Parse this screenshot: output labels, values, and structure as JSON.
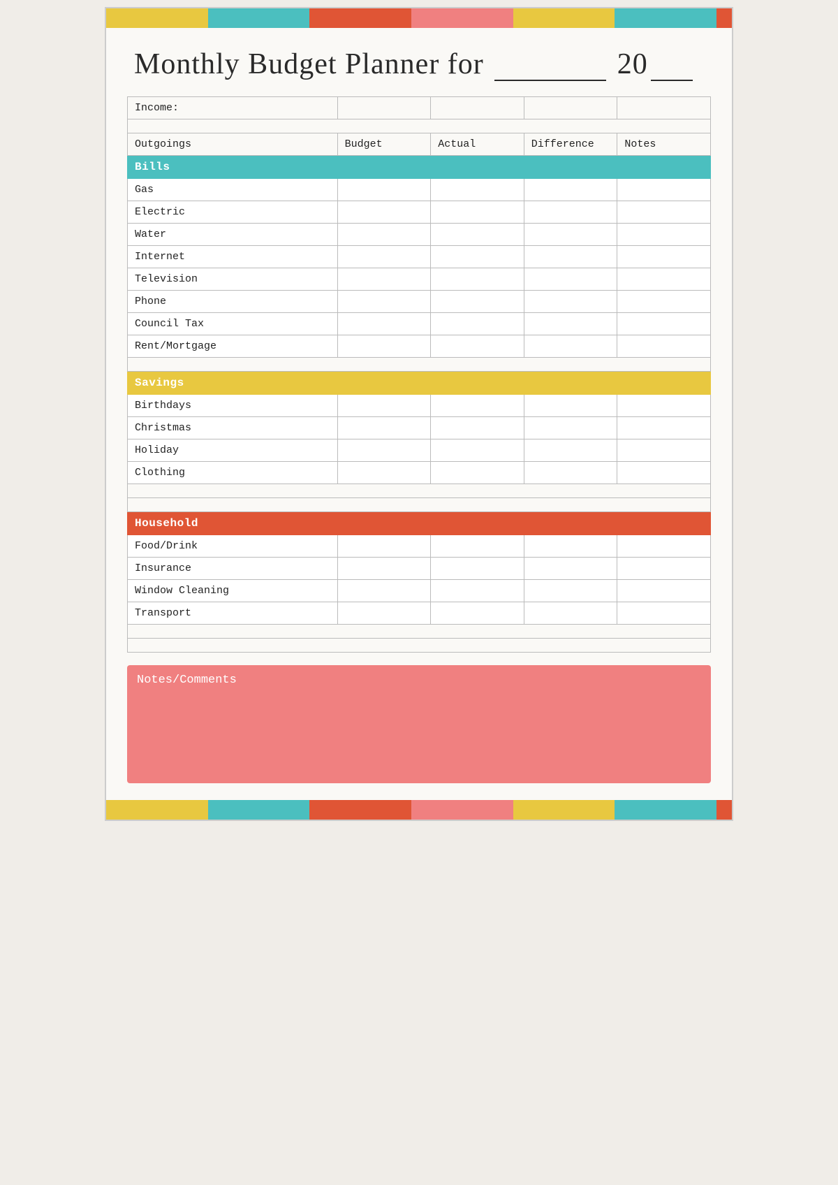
{
  "title": {
    "main": "Monthly Budget Planner for",
    "year_prefix": "20",
    "year_suffix": "__"
  },
  "colorBarsTop": [
    {
      "color": "#e8c840",
      "flex": 2
    },
    {
      "color": "#4bbfbf",
      "flex": 2
    },
    {
      "color": "#e05535",
      "flex": 2
    },
    {
      "color": "#f08080",
      "flex": 2
    },
    {
      "color": "#e8c840",
      "flex": 2
    },
    {
      "color": "#4bbfbf",
      "flex": 2
    },
    {
      "color": "#e05535",
      "flex": 0.3
    }
  ],
  "colorBarsBottom": [
    {
      "color": "#e8c840",
      "flex": 2
    },
    {
      "color": "#4bbfbf",
      "flex": 2
    },
    {
      "color": "#e05535",
      "flex": 2
    },
    {
      "color": "#f08080",
      "flex": 2
    },
    {
      "color": "#e8c840",
      "flex": 2
    },
    {
      "color": "#4bbfbf",
      "flex": 2
    },
    {
      "color": "#e05535",
      "flex": 0.3
    }
  ],
  "table": {
    "income_label": "Income:",
    "headers": {
      "outgoings": "Outgoings",
      "budget": "Budget",
      "actual": "Actual",
      "difference": "Difference",
      "notes": "Notes"
    },
    "bills_label": "Bills",
    "bills_rows": [
      "Gas",
      "Electric",
      "Water",
      "Internet",
      "Television",
      "Phone",
      "Council Tax",
      "Rent/Mortgage"
    ],
    "savings_label": "Savings",
    "savings_rows": [
      "Birthdays",
      "Christmas",
      "Holiday",
      "Clothing"
    ],
    "household_label": "Household",
    "household_rows": [
      "Food/Drink",
      "Insurance",
      "Window Cleaning",
      "Transport"
    ]
  },
  "notes": {
    "title": "Notes/Comments"
  }
}
